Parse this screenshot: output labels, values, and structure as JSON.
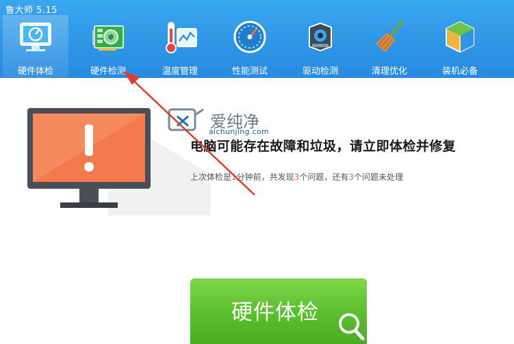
{
  "app": {
    "title": "鲁大师 5.15"
  },
  "nav": [
    {
      "label": "硬件体检",
      "icon": "monitor-check-icon",
      "active": true
    },
    {
      "label": "硬件检测",
      "icon": "circuit-board-icon",
      "active": false
    },
    {
      "label": "温度管理",
      "icon": "thermometer-icon",
      "active": false
    },
    {
      "label": "性能测试",
      "icon": "speedometer-icon",
      "active": false
    },
    {
      "label": "驱动检测",
      "icon": "gear-box-icon",
      "active": false
    },
    {
      "label": "清理优化",
      "icon": "broom-icon",
      "active": false
    },
    {
      "label": "装机必备",
      "icon": "package-box-icon",
      "active": false
    }
  ],
  "watermark": {
    "title": "爱纯净",
    "url": "aichunjing.com"
  },
  "status": {
    "headline": "电脑可能存在故障和垃圾，请立即体检并修复",
    "sub": {
      "p1": "上次体检是",
      "n1": "1",
      "p2": "分钟前，共发现",
      "n2": "3",
      "p3": "个问题，还有",
      "n3": "3",
      "p4": "个问题未处理"
    }
  },
  "action": {
    "label": "硬件体检",
    "icon": "magnifier-icon"
  },
  "colors": {
    "toolbar": "#2f96e6",
    "button": "#5cc12e",
    "accent": "#f06a2a",
    "arrow": "#e23b2e"
  }
}
